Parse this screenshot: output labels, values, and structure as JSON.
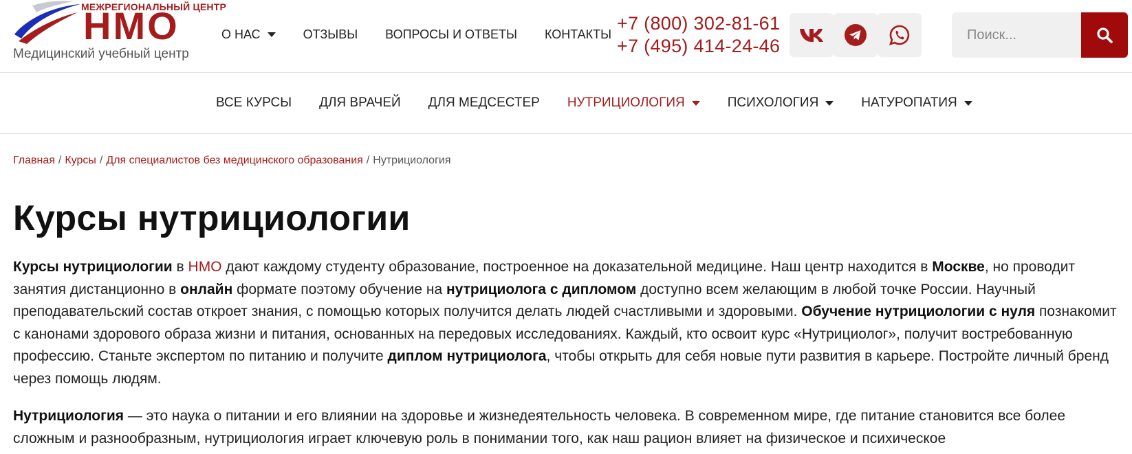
{
  "logo": {
    "top_text": "МЕЖРЕГИОНАЛЬНЫЙ ЦЕНТР",
    "main_text": "НМО",
    "subtitle": "Медицинский учебный центр"
  },
  "top_nav": {
    "items": [
      {
        "label": "О НАС",
        "has_dropdown": true
      },
      {
        "label": "ОТЗЫВЫ",
        "has_dropdown": false
      },
      {
        "label": "ВОПРОСЫ И ОТВЕТЫ",
        "has_dropdown": false
      },
      {
        "label": "КОНТАКТЫ",
        "has_dropdown": false
      }
    ]
  },
  "phones": [
    "+7 (800) 302-81-61",
    "+7 (495) 414-24-46"
  ],
  "social": [
    {
      "name": "vk-icon"
    },
    {
      "name": "telegram-icon"
    },
    {
      "name": "whatsapp-icon"
    }
  ],
  "search": {
    "placeholder": "Поиск...",
    "value": "",
    "icon": "search-icon"
  },
  "category_nav": {
    "items": [
      {
        "label": "ВСЕ КУРСЫ",
        "has_dropdown": false,
        "active": false
      },
      {
        "label": "ДЛЯ ВРАЧЕЙ",
        "has_dropdown": false,
        "active": false
      },
      {
        "label": "ДЛЯ МЕДСЕСТЕР",
        "has_dropdown": false,
        "active": false
      },
      {
        "label": "НУТРИЦИОЛОГИЯ",
        "has_dropdown": true,
        "active": true
      },
      {
        "label": "ПСИХОЛОГИЯ",
        "has_dropdown": true,
        "active": false
      },
      {
        "label": "НАТУРОПАТИЯ",
        "has_dropdown": true,
        "active": false
      }
    ]
  },
  "breadcrumb": {
    "items": [
      "Главная",
      "Курсы",
      "Для специалистов без медицинского образования"
    ],
    "separator": "/",
    "current": "Нутрициология"
  },
  "page_title": "Курсы нутрициологии",
  "paragraph1": {
    "s1": "Курсы нутрициологии",
    "s2": " в ",
    "s3": "НМО",
    "s4": " дают каждому студенту образование, построенное на доказательной медицине. Наш центр находится в ",
    "s5": "Москве",
    "s6": ", но проводит занятия дистанционно в ",
    "s7": "онлайн",
    "s8": " формате поэтому обучение на ",
    "s9": "нутрициолога с дипломом",
    "s10": " доступно всем желающим в любой точке России. Научный преподавательский состав откроет знания, с помощью которых получится делать людей счастливыми и здоровыми. ",
    "s11": "Обучение нутрициологии с нуля",
    "s12": " познакомит с канонами здорового образа жизни и питания, основанных на передовых исследованиях. Каждый, кто освоит курс «Нутрициолог», получит востребованную профессию. Станьте экспертом по питанию и получите ",
    "s13": "диплом нутрициолога",
    "s14": ", чтобы открыть для себя новые пути развития в карьере. Постройте личный бренд через помощь людям."
  },
  "paragraph2": {
    "s1": "Нутрициология",
    "s2": " — это наука о питании и его влиянии на здоровье и жизнедеятельность человека. В современном мире, где питание становится все более сложным и разнообразным, нутрициология играет ключевую роль в понимании того, как наш рацион влияет на физическое и психическое"
  },
  "colors": {
    "brand_red": "#a51c1c",
    "search_button": "#a00a0a",
    "logo_blue": "#1a2fb5"
  }
}
